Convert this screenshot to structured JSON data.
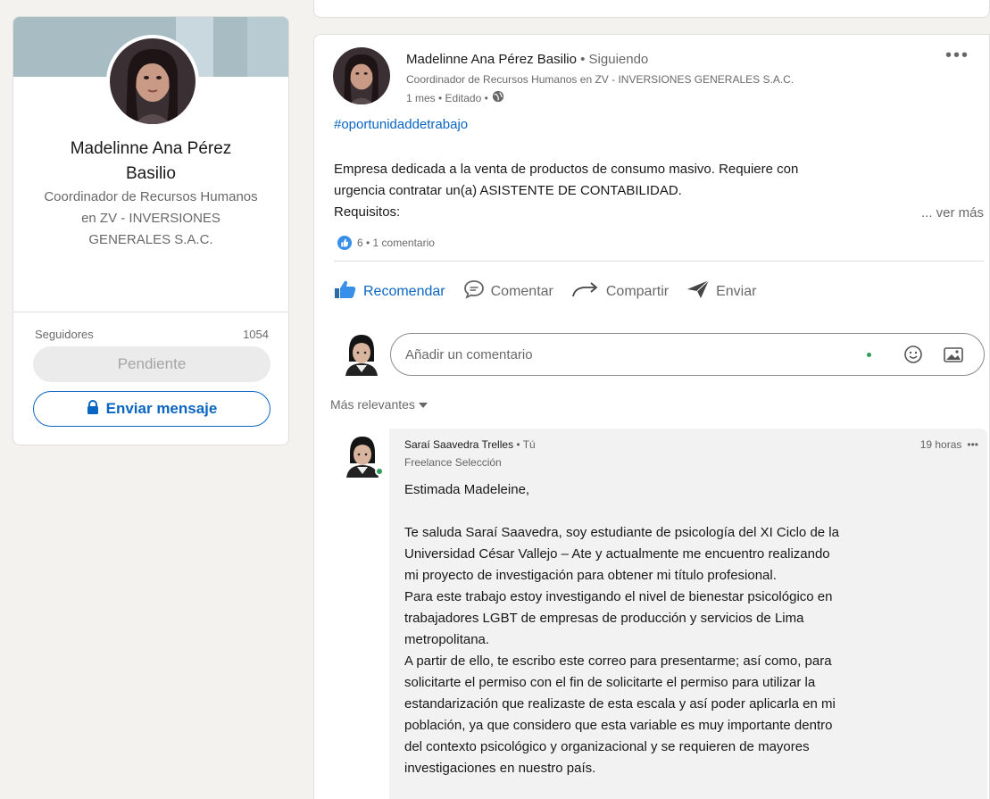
{
  "profile": {
    "name": "Madelinne Ana Pérez Basilio",
    "headline": "Coordinador de Recursos Humanos en ZV - INVERSIONES GENERALES S.A.C.",
    "followers_label": "Seguidores",
    "followers_count": "1054",
    "pending_label": "Pendiente",
    "message_label": "Enviar mensaje"
  },
  "post": {
    "author": "Madelinne Ana Pérez Basilio",
    "following": "• Siguiendo",
    "headline": "Coordinador de Recursos Humanos en ZV - INVERSIONES GENERALES S.A.C.",
    "meta": "1 mes • Editado •",
    "hashtag": "#oportunidaddetrabajo",
    "body": [
      "Empresa dedicada a la venta de productos de consumo masivo. Requiere con",
      "urgencia contratar un(a) ASISTENTE DE CONTABILIDAD.",
      "Requisitos:"
    ],
    "see_more": "... ver más",
    "reactions": "6 • 1 comentario",
    "more": "•••"
  },
  "actions": {
    "like": "Recomendar",
    "comment": "Comentar",
    "share": "Compartir",
    "send": "Enviar"
  },
  "comment_box": {
    "placeholder": "Añadir un comentario"
  },
  "sort": {
    "label": "Más relevantes"
  },
  "reply": {
    "author": "Saraí Saavedra Trelles",
    "you": "• Tú",
    "headline": "Freelance Selección",
    "time": "19 horas",
    "more": "•••",
    "greeting": "Estimada Madeleine,",
    "lines": [
      "Te saluda Saraí Saavedra, soy estudiante de psicología del XI Ciclo de la",
      "Universidad César Vallejo – Ate y actualmente me encuentro realizando",
      "mi proyecto de investigación para obtener mi título profesional.",
      "Para este trabajo estoy investigando el nivel de bienestar psicológico en",
      "trabajadores LGBT de empresas de producción y servicios de Lima",
      "metropolitana.",
      "A partir de ello, te escribo este correo para presentarme; así como, para",
      "solicitarte el permiso con el fin de solicitarte el permiso para utilizar la",
      "estandarización que realizaste de esta escala y así poder aplicarla en mi",
      "población, ya que considero que esta variable es muy importante dentro",
      "del contexto psicológico y organizacional y se requieren de mayores",
      "investigaciones en nuestro país."
    ]
  },
  "colors": {
    "accent": "#0a66c2",
    "reaction": "#378fe9",
    "online": "#2e9d5b"
  }
}
